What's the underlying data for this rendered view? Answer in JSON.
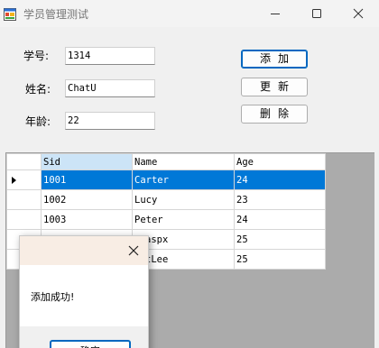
{
  "window": {
    "title": "学员管理测试",
    "icon": "winforms-app-icon",
    "controls": [
      "minimize-icon",
      "maximize-icon",
      "close-icon"
    ]
  },
  "form": {
    "sid_label": "学号:",
    "sid_value": "1314",
    "name_label": "姓名:",
    "name_value": "ChatU",
    "age_label": "年龄:",
    "age_value": "22"
  },
  "buttons": {
    "add": "添加",
    "update": "更新",
    "delete": "删除"
  },
  "grid": {
    "columns": [
      "Sid",
      "Name",
      "Age"
    ],
    "rows": [
      [
        "1001",
        "Carter",
        "24"
      ],
      [
        "1002",
        "Lucy",
        "23"
      ],
      [
        "1003",
        "Peter",
        "24"
      ],
      [
        "",
        "aspx",
        "25"
      ],
      [
        "",
        "tLee",
        "25"
      ]
    ],
    "selected_row": 0,
    "colors": {
      "selection": "#0078d7",
      "header_selected": "#cce4f7",
      "background": "#ababab"
    }
  },
  "messagebox": {
    "text": "添加成功!",
    "ok_label": "确定"
  }
}
